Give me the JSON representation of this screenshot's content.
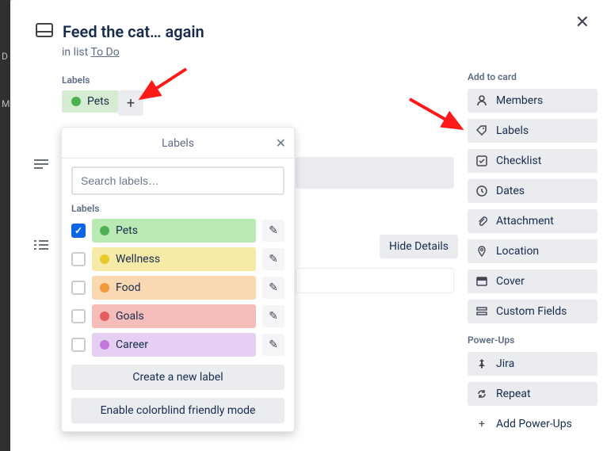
{
  "card": {
    "title": "Feed the cat… again",
    "list_prefix": "in list ",
    "list_name": "To Do"
  },
  "labels_section": {
    "heading": "Labels",
    "assigned": {
      "name": "Pets"
    }
  },
  "labels_popover": {
    "title": "Labels",
    "search_placeholder": "Search labels…",
    "list_heading": "Labels",
    "items": [
      {
        "name": "Pets",
        "checked": true
      },
      {
        "name": "Wellness",
        "checked": false
      },
      {
        "name": "Food",
        "checked": false
      },
      {
        "name": "Goals",
        "checked": false
      },
      {
        "name": "Career",
        "checked": false
      }
    ],
    "create_btn": "Create a new label",
    "colorblind_btn": "Enable colorblind friendly mode"
  },
  "sidebar": {
    "add_heading": "Add to card",
    "items": [
      {
        "label": "Members"
      },
      {
        "label": "Labels"
      },
      {
        "label": "Checklist"
      },
      {
        "label": "Dates"
      },
      {
        "label": "Attachment"
      },
      {
        "label": "Location"
      },
      {
        "label": "Cover"
      },
      {
        "label": "Custom Fields"
      }
    ],
    "powerups_heading": "Power-Ups",
    "powerups": [
      {
        "label": "Jira"
      },
      {
        "label": "Repeat"
      }
    ],
    "add_powerups": "Add Power-Ups"
  },
  "hide_details": "Hide Details",
  "colors": {
    "green": "#4fb052",
    "yellow": "#e6c92b",
    "orange": "#f19a3e",
    "red": "#e45e5e",
    "purple": "#c277dc"
  }
}
